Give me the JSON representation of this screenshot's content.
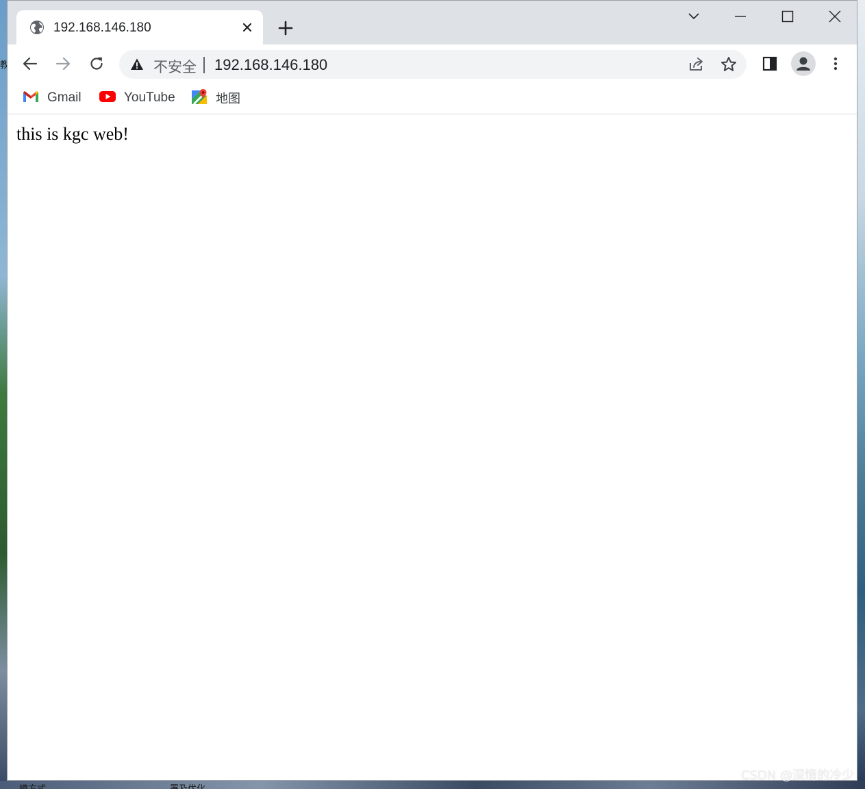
{
  "desktop": {
    "left_glyph": "教",
    "bottom_texts": [
      "模方式",
      "署及优化"
    ],
    "watermark": "CSDN @深情的冷少"
  },
  "browser": {
    "tab": {
      "title": "192.168.146.180",
      "favicon": "globe-icon"
    },
    "window_controls": [
      "tab-search-icon",
      "minimize-icon",
      "maximize-icon",
      "close-icon"
    ],
    "omnibox": {
      "security_text": "不安全",
      "url": "192.168.146.180"
    },
    "bookmarks": [
      {
        "label": "Gmail",
        "icon": "gmail-icon"
      },
      {
        "label": "YouTube",
        "icon": "youtube-icon"
      },
      {
        "label": "地图",
        "icon": "maps-icon"
      }
    ]
  },
  "page": {
    "body_text": "this is kgc web!"
  },
  "colors": {
    "tabstrip": "#dee1e6",
    "omnibox": "#f1f3f4",
    "icon": "#5f6368",
    "text": "#202124"
  }
}
